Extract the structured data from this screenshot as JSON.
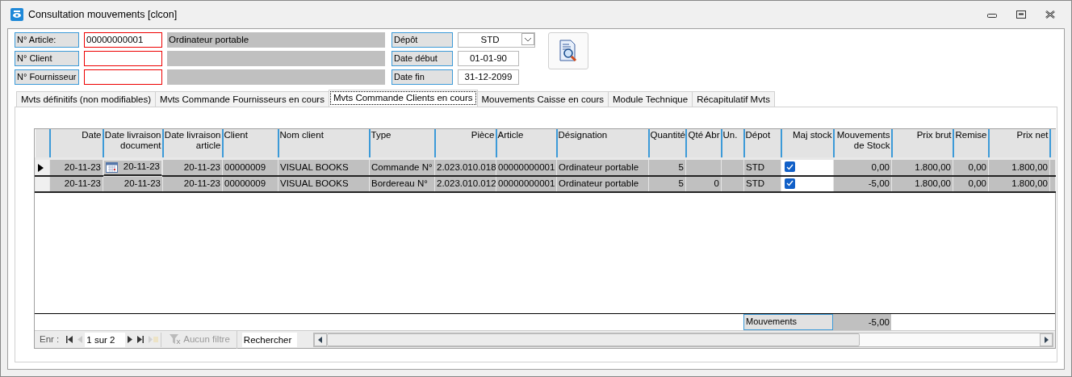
{
  "window": {
    "title": "Consultation mouvements [clcon]"
  },
  "filters": [
    {
      "label": "N° Article:",
      "value": "00000000001",
      "description": "Ordinateur portable"
    },
    {
      "label": "N° Client"
    },
    {
      "label": "N° Fournisseur"
    }
  ],
  "options": [
    {
      "label": "Dépôt",
      "value": "STD",
      "kind": "dropdown"
    },
    {
      "label": "Date début",
      "value": "01-01-90",
      "kind": "text"
    },
    {
      "label": "Date fin",
      "value": "31-12-2099",
      "kind": "text"
    }
  ],
  "tabs": [
    {
      "label": "Mvts définitifs (non modifiables)",
      "selected": false
    },
    {
      "label": "Mvts Commande Fournisseurs en cours",
      "selected": false
    },
    {
      "label": "Mvts Commande Clients en cours",
      "selected": true
    },
    {
      "label": "Mouvements Caisse en cours",
      "selected": false
    },
    {
      "label": "Module Technique",
      "selected": false
    },
    {
      "label": "Récapitulatif Mvts",
      "selected": false
    }
  ],
  "table": {
    "columns": [
      {
        "label": "Date",
        "kind": "date"
      },
      {
        "label": "Date livraison document",
        "kind": "datepicker"
      },
      {
        "label": "Date livraison article",
        "kind": "date"
      },
      {
        "label": "Client",
        "kind": "text"
      },
      {
        "label": "Nom client",
        "kind": "text"
      },
      {
        "label": "Type",
        "kind": "text"
      },
      {
        "label": "Pièce",
        "kind": "number"
      },
      {
        "label": "Article",
        "kind": "text"
      },
      {
        "label": "Désignation",
        "kind": "text"
      },
      {
        "label": "Quantité",
        "kind": "number"
      },
      {
        "label": "Qté Abr",
        "kind": "number"
      },
      {
        "label": "Un.",
        "kind": "text"
      },
      {
        "label": "Dépot",
        "kind": "text"
      },
      {
        "label": "Maj stock",
        "kind": "checkbox"
      },
      {
        "label": "Mouvements de Stock",
        "kind": "number"
      },
      {
        "label": "Prix brut",
        "kind": "number"
      },
      {
        "label": "Remise",
        "kind": "number"
      },
      {
        "label": "Prix net",
        "kind": "number"
      }
    ],
    "rows": [
      {
        "current": true,
        "cells": [
          "20-11-23",
          "20-11-23",
          "20-11-23",
          "00000009",
          "VISUAL BOOKS",
          "Commande N°",
          "2.023.010.018",
          "00000000001",
          "Ordinateur portable",
          "5",
          null,
          null,
          "STD",
          true,
          "0,00",
          "1.800,00",
          "0,00",
          "1.800,00"
        ]
      },
      {
        "current": false,
        "cells": [
          "20-11-23",
          "20-11-23",
          "20-11-23",
          "00000009",
          "VISUAL BOOKS",
          "Bordereau N°",
          "2.023.010.012",
          "00000000001",
          "Ordinateur portable",
          "5",
          "0",
          null,
          "STD",
          true,
          "-5,00",
          "1.800,00",
          "0,00",
          "1.800,00"
        ]
      }
    ],
    "footer": {
      "label": "Mouvements",
      "value": "-5,00"
    }
  },
  "navigator": {
    "label": "Enr :",
    "position": "1 sur 2",
    "filter": "Aucun filtre",
    "search": "Rechercher"
  }
}
